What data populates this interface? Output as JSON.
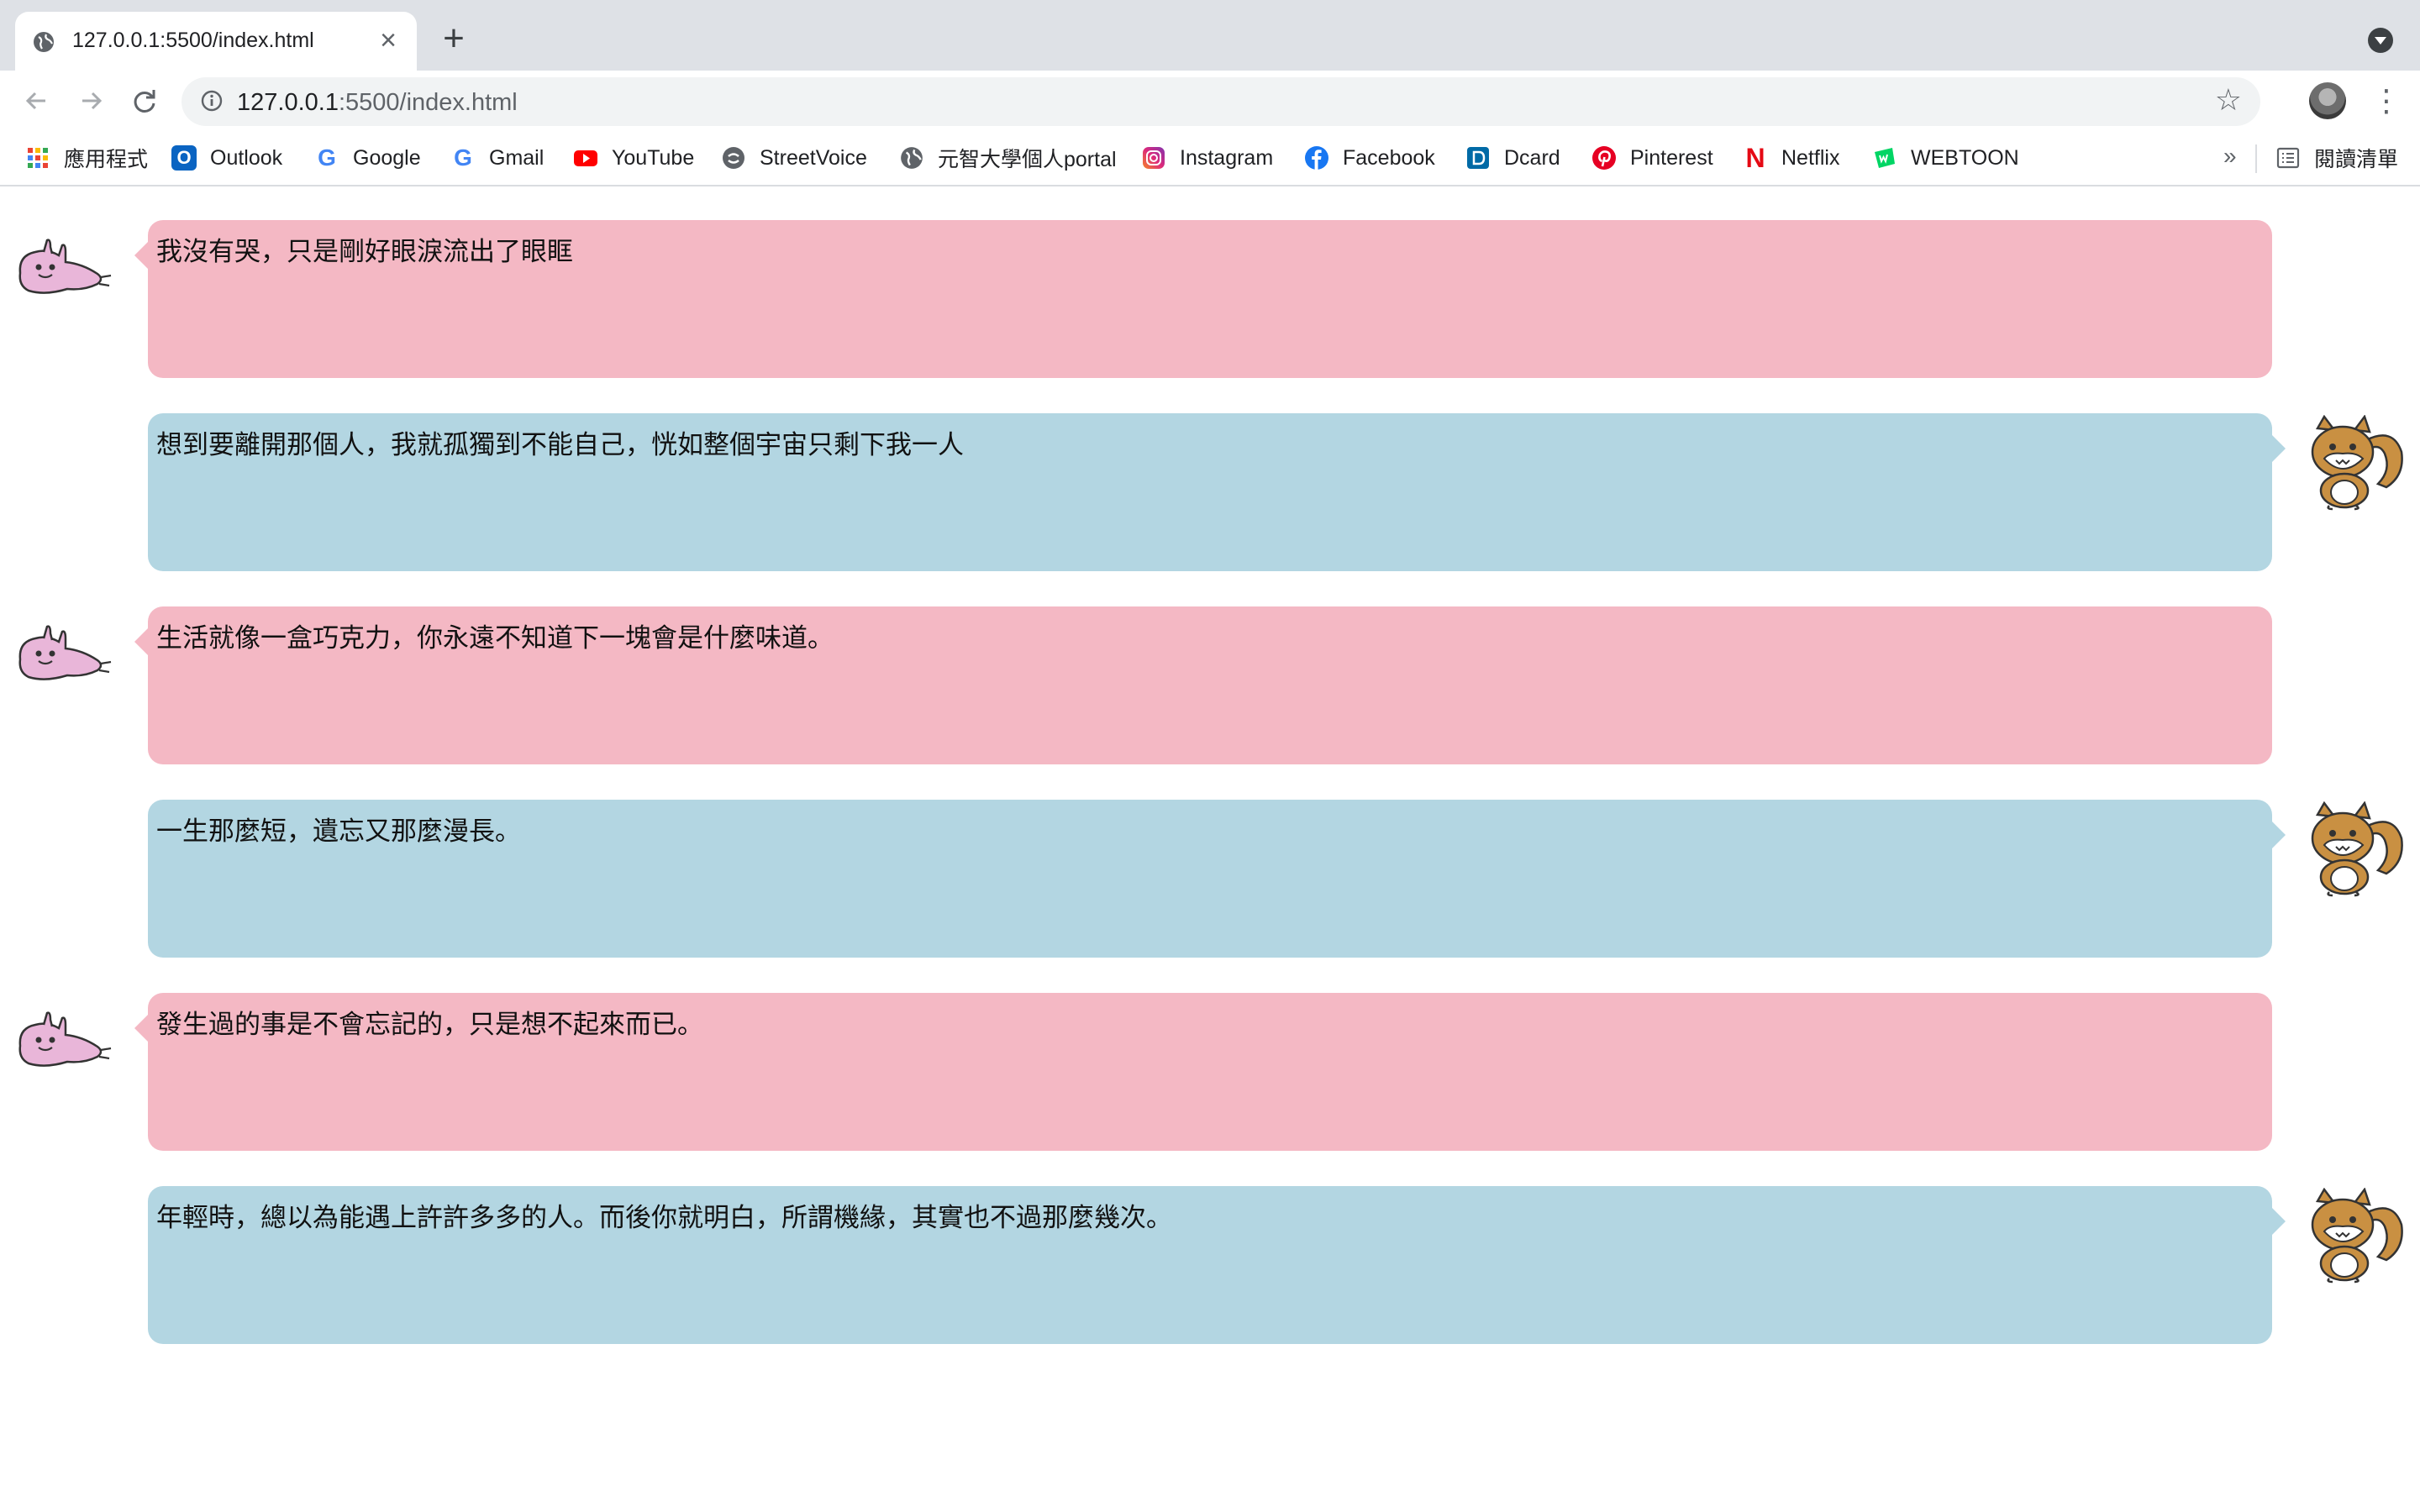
{
  "browser": {
    "tab_title": "127.0.0.1:5500/index.html",
    "url_host": "127.0.0.1",
    "url_rest": ":5500/index.html",
    "new_tab": "+",
    "close": "×"
  },
  "bookmarks": [
    {
      "label": "應用程式",
      "icon": "apps-grid-icon"
    },
    {
      "label": "Outlook",
      "icon": "outlook-icon",
      "color": "#0a64c2"
    },
    {
      "label": "Google",
      "icon": "google-icon"
    },
    {
      "label": "Gmail",
      "icon": "google-icon"
    },
    {
      "label": "YouTube",
      "icon": "youtube-icon",
      "color": "#ff0000"
    },
    {
      "label": "StreetVoice",
      "icon": "streetvoice-icon",
      "color": "#5f6368"
    },
    {
      "label": "元智大學個人portal",
      "icon": "globe-icon"
    },
    {
      "label": "Instagram",
      "icon": "instagram-icon",
      "color": "#c13584"
    },
    {
      "label": "Facebook",
      "icon": "facebook-icon",
      "color": "#1877f2"
    },
    {
      "label": "Dcard",
      "icon": "dcard-icon",
      "color": "#006aa6"
    },
    {
      "label": "Pinterest",
      "icon": "pinterest-icon",
      "color": "#e60023"
    },
    {
      "label": "Netflix",
      "icon": "netflix-icon",
      "color": "#e50914"
    },
    {
      "label": "WEBTOON",
      "icon": "webtoon-icon",
      "color": "#00d564"
    }
  ],
  "bookmarks_more": "»",
  "reading_list": "閱讀清單",
  "messages": [
    {
      "speaker": "rabbit",
      "color": "#f4b8c4",
      "text": "我沒有哭，只是剛好眼淚流出了眼眶"
    },
    {
      "speaker": "squirrel",
      "color": "#b3d6e2",
      "text": "想到要離開那個人，我就孤獨到不能自己，恍如整個宇宙只剩下我一人"
    },
    {
      "speaker": "rabbit",
      "color": "#f4b8c4",
      "text": "生活就像一盒巧克力，你永遠不知道下一塊會是什麼味道。"
    },
    {
      "speaker": "squirrel",
      "color": "#b3d6e2",
      "text": "一生那麼短，遺忘又那麼漫長。"
    },
    {
      "speaker": "rabbit",
      "color": "#f4b8c4",
      "text": "發生過的事是不會忘記的，只是想不起來而已。"
    },
    {
      "speaker": "squirrel",
      "color": "#b3d6e2",
      "text": "年輕時，總以為能遇上許許多多的人。而後你就明白，所謂機緣，其實也不過那麼幾次。"
    }
  ]
}
